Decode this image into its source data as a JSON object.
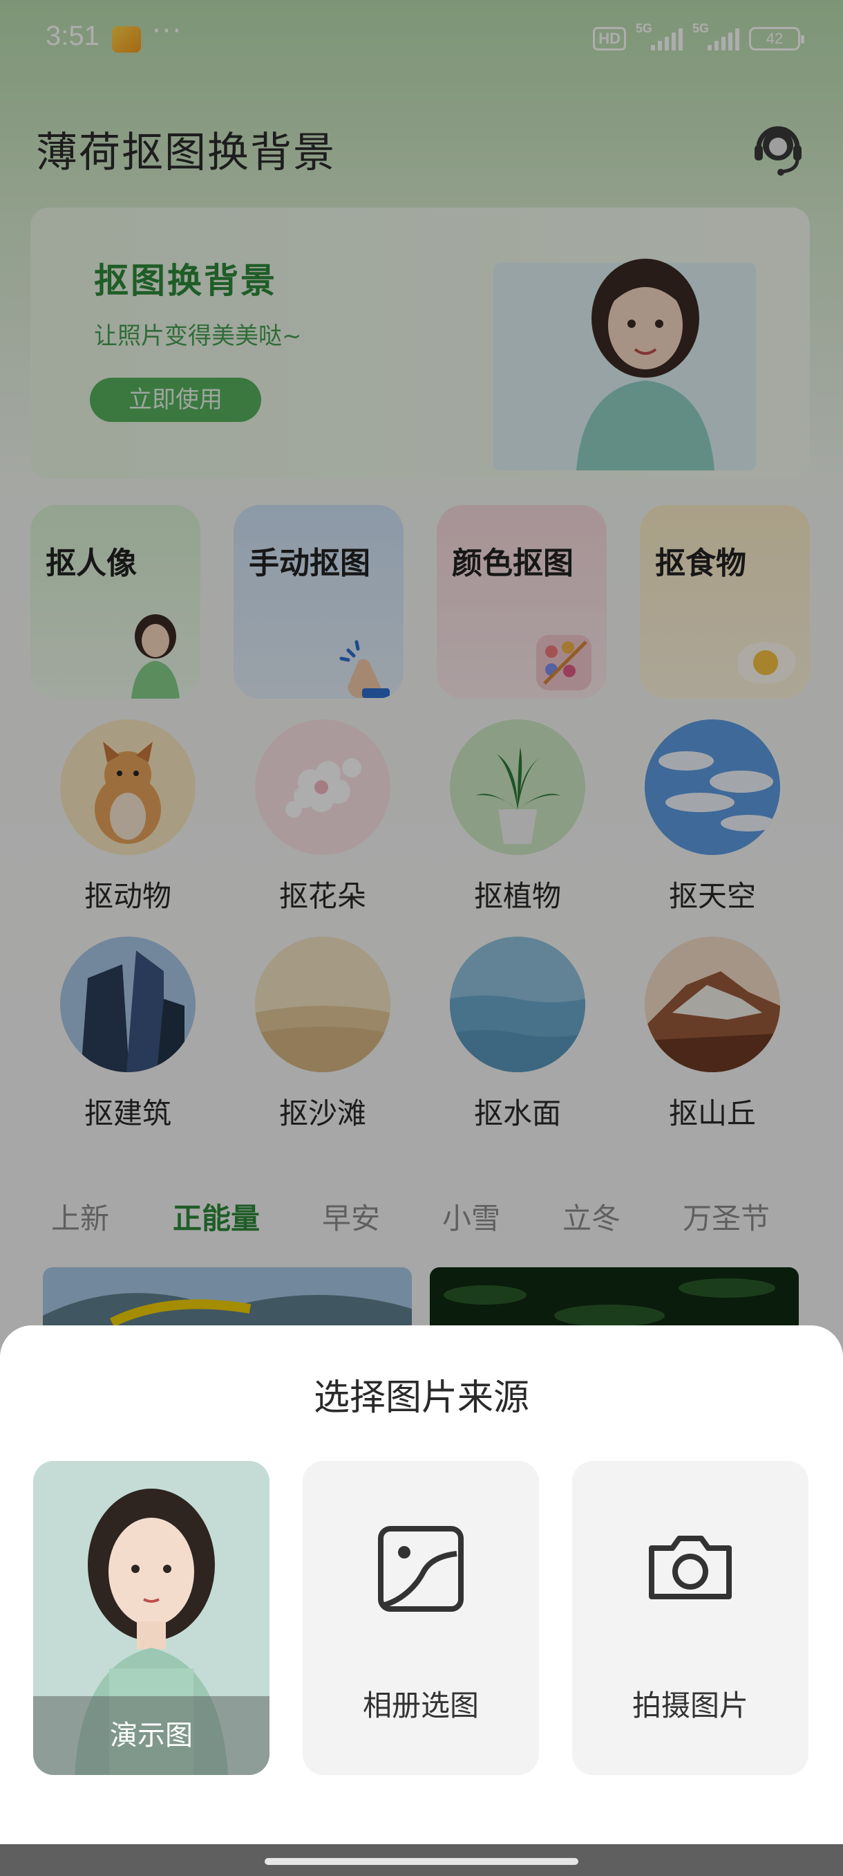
{
  "status": {
    "time": "3:51",
    "more": "···",
    "hd": "HD",
    "net1": "5G",
    "net2": "5G",
    "battery": "42"
  },
  "app": {
    "title": "薄荷抠图换背景",
    "support_icon": "headset-icon"
  },
  "banner": {
    "title": "抠图换背景",
    "subtitle": "让照片变得美美哒~",
    "button": "立即使用"
  },
  "features": [
    {
      "label": "抠人像",
      "icon": "portrait-icon"
    },
    {
      "label": "手动抠图",
      "icon": "tap-hand-icon"
    },
    {
      "label": "颜色抠图",
      "icon": "palette-icon"
    },
    {
      "label": "抠食物",
      "icon": "egg-icon"
    }
  ],
  "categories": [
    {
      "label": "抠动物",
      "icon": "fox-image"
    },
    {
      "label": "抠花朵",
      "icon": "flower-image"
    },
    {
      "label": "抠植物",
      "icon": "plant-image"
    },
    {
      "label": "抠天空",
      "icon": "sky-image"
    },
    {
      "label": "抠建筑",
      "icon": "building-image"
    },
    {
      "label": "抠沙滩",
      "icon": "beach-image"
    },
    {
      "label": "抠水面",
      "icon": "water-image"
    },
    {
      "label": "抠山丘",
      "icon": "hill-image"
    }
  ],
  "tabs": [
    "上新",
    "正能量",
    "早安",
    "小雪",
    "立冬",
    "万圣节"
  ],
  "active_tab": "正能量",
  "sheet": {
    "title": "选择图片来源",
    "options": [
      {
        "label": "演示图",
        "icon": "demo-photo"
      },
      {
        "label": "相册选图",
        "icon": "gallery-icon"
      },
      {
        "label": "拍摄图片",
        "icon": "camera-icon"
      }
    ]
  },
  "colors": {
    "brand_green": "#2f8a3a",
    "dim_overlay": "rgba(0,0,0,0.32)"
  }
}
